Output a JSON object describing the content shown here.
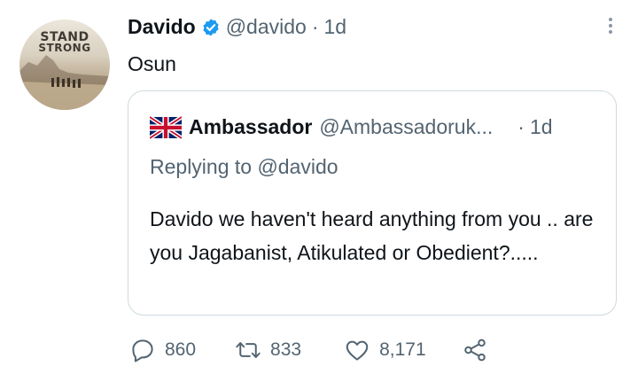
{
  "avatar": {
    "text_line1": "STAND",
    "text_line2": "STRONG"
  },
  "tweet": {
    "name": "Davido",
    "handle": "@davido",
    "separator": "·",
    "time": "1d",
    "text": "Osun"
  },
  "quote": {
    "name": "Ambassador",
    "handle": "@Ambassadoruk...",
    "separator": "·",
    "time": "1d",
    "replying": "Replying to @davido",
    "text": "Davido we haven't heard anything from you .. are you Jagabanist, Atikulated or Obedient?....."
  },
  "actions": {
    "reply_count": "860",
    "retweet_count": "833",
    "like_count": "8,171"
  },
  "icons": {
    "verified": "verified-badge-icon",
    "more": "more-options-icon",
    "flag": "uk-flag-icon",
    "reply": "reply-icon",
    "retweet": "retweet-icon",
    "like": "heart-icon",
    "share": "share-icon"
  },
  "colors": {
    "verified": "#1d9bf0",
    "secondary_text": "#536471",
    "border": "#cfd9de"
  }
}
